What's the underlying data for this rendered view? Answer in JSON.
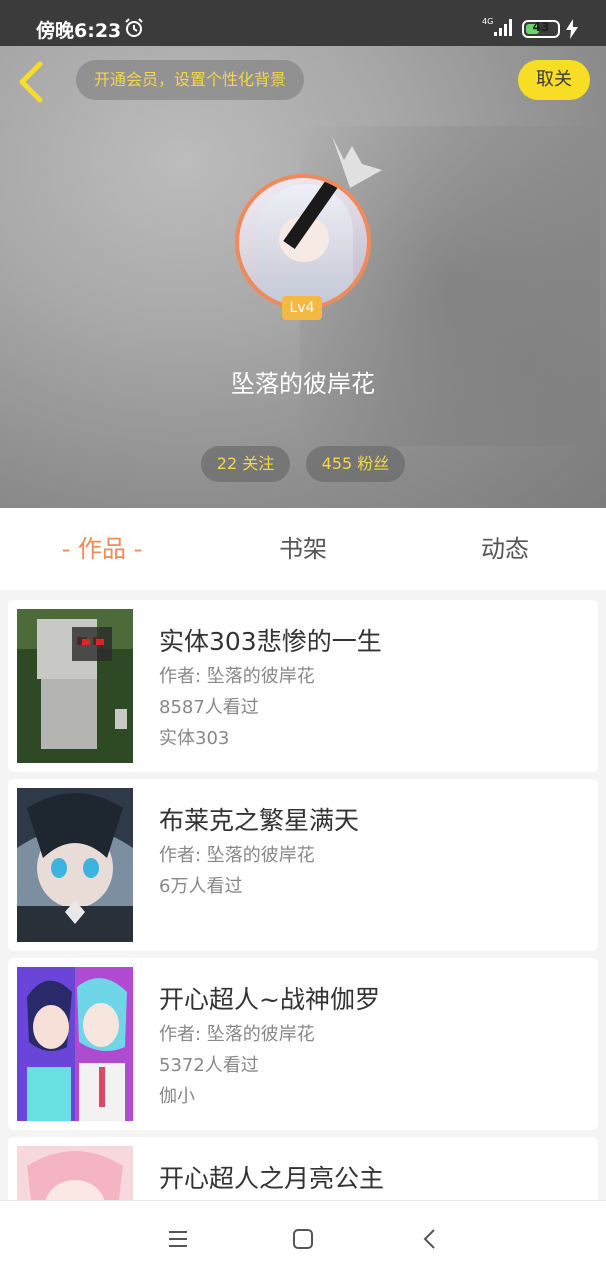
{
  "status_bar": {
    "time": "傍晚6:23",
    "network": "4G",
    "battery": "43",
    "battery_level": 0.43
  },
  "header": {
    "vip_banner": "开通会员，设置个性化背景",
    "unfollow_label": "取关",
    "level": "Lv4",
    "username": "坠落的彼岸花",
    "following": "22 关注",
    "fans": "455 粉丝"
  },
  "tabs": [
    {
      "label": "- 作品 -",
      "active": true
    },
    {
      "label": "书架",
      "active": false
    },
    {
      "label": "动态",
      "active": false
    }
  ],
  "works": [
    {
      "title": "实体303悲惨的一生",
      "author": "作者: 坠落的彼岸花",
      "views": "8587人看过",
      "tag": "实体303"
    },
    {
      "title": "布莱克之繁星满天",
      "author": "作者: 坠落的彼岸花",
      "views": "6万人看过",
      "tag": ""
    },
    {
      "title": "开心超人~战神伽罗",
      "author": "作者: 坠落的彼岸花",
      "views": "5372人看过",
      "tag": "伽小"
    },
    {
      "title": "开心超人之月亮公主",
      "author": "",
      "views": "",
      "tag": ""
    }
  ],
  "colors": {
    "accent": "#ef8a5a",
    "gold": "#f3d64a",
    "unfollow_bg": "#f8dd25"
  },
  "icons": {
    "nav_menu": "menu-icon",
    "nav_home": "home-icon",
    "nav_back": "back-icon"
  }
}
